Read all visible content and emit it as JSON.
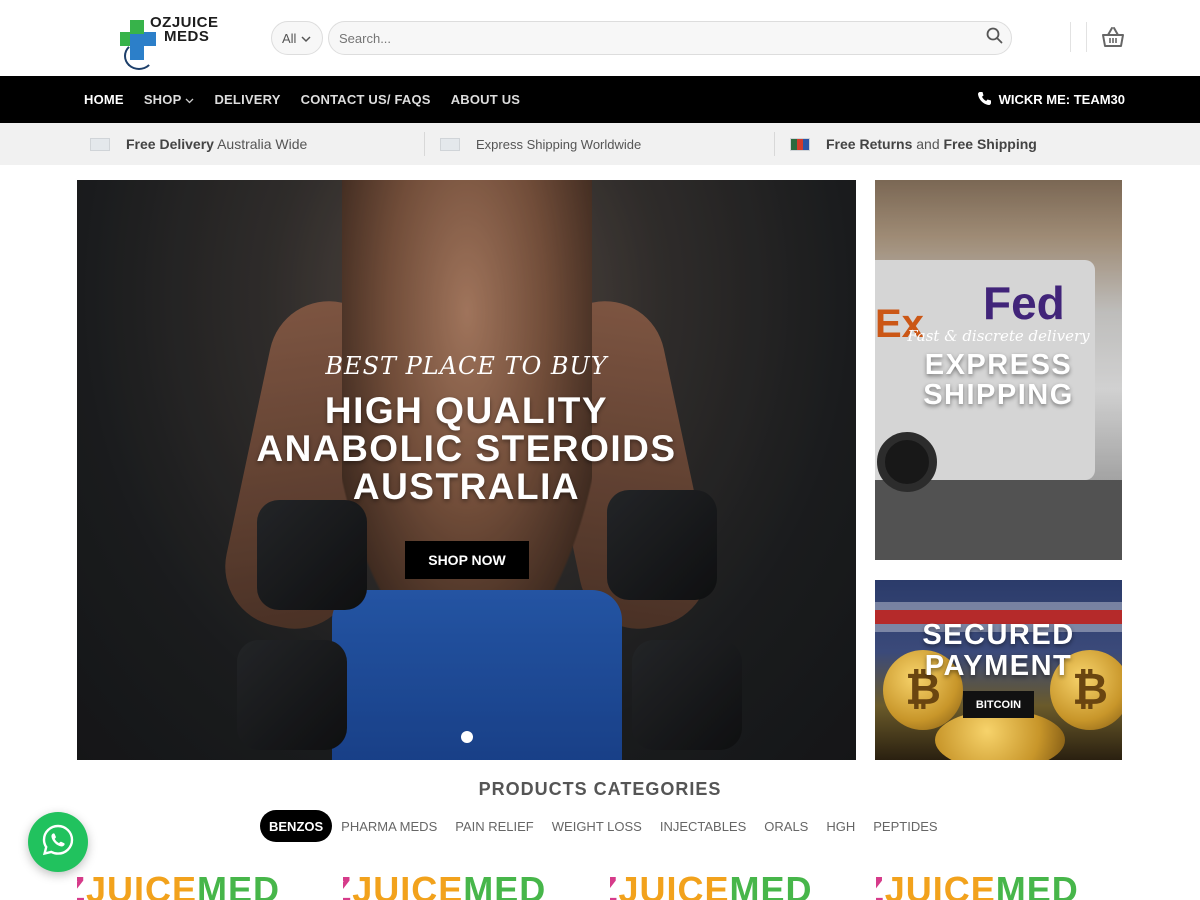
{
  "brand": {
    "line1": "OZJUICE",
    "line2": "MEDS"
  },
  "search": {
    "category": "All",
    "placeholder": "Search..."
  },
  "nav": {
    "items": [
      {
        "label": "HOME",
        "active": true
      },
      {
        "label": "SHOP",
        "has_dropdown": true
      },
      {
        "label": "DELIVERY"
      },
      {
        "label": "CONTACT US/ FAQS"
      },
      {
        "label": "ABOUT US"
      }
    ],
    "contact": "WICKR ME: TEAM30"
  },
  "infobar": [
    {
      "bold": "Free Delivery",
      "text": " Australia Wide"
    },
    {
      "bold": "",
      "text": "Express Shipping Worldwide"
    },
    {
      "bold": "Free Returns",
      "text": " and ",
      "bold2": "Free Shipping"
    }
  ],
  "hero": {
    "subtitle": "BEST PLACE TO BUY",
    "title_line1": "HIGH QUALITY",
    "title_line2": "ANABOLIC STEROIDS",
    "title_line3": "AUSTRALIA",
    "button": "SHOP NOW",
    "slide_count": 1
  },
  "banner_shipping": {
    "subtitle": "Fast & discrete delivery",
    "title_line1": "EXPRESS",
    "title_line2": "SHIPPING",
    "van_text_1": "Fed",
    "van_text_2": "Ex"
  },
  "banner_payment": {
    "title_line1": "SECURED",
    "title_line2": "PAYMENT",
    "button": "BITCOIN"
  },
  "categories": {
    "heading": "PRODUCTS CATEGORIES",
    "tabs": [
      "BENZOS",
      "PHARMA MEDS",
      "PAIN RELIEF",
      "WEIGHT LOSS",
      "INJECTABLES",
      "ORALS",
      "HGH",
      "PEPTIDES"
    ],
    "active": "BENZOS"
  },
  "products": [
    {
      "brand_a": "Z",
      "brand_b": "JUICE",
      "brand_c": "MED"
    },
    {
      "brand_a": "Z",
      "brand_b": "JUICE",
      "brand_c": "MED"
    },
    {
      "brand_a": "Z",
      "brand_b": "JUICE",
      "brand_c": "MED"
    },
    {
      "brand_a": "Z",
      "brand_b": "JUICE",
      "brand_c": "MED"
    }
  ],
  "colors": {
    "nav_bg": "#000000",
    "infobar_bg": "#f1f1f1",
    "whatsapp": "#21c25e",
    "logo_blue": "#2c7fc9",
    "logo_green": "#37b34a"
  },
  "icons": {
    "search": "search-icon",
    "cart": "basket-icon",
    "phone": "phone-icon",
    "whatsapp": "whatsapp-icon",
    "chevron": "chevron-down-icon"
  }
}
